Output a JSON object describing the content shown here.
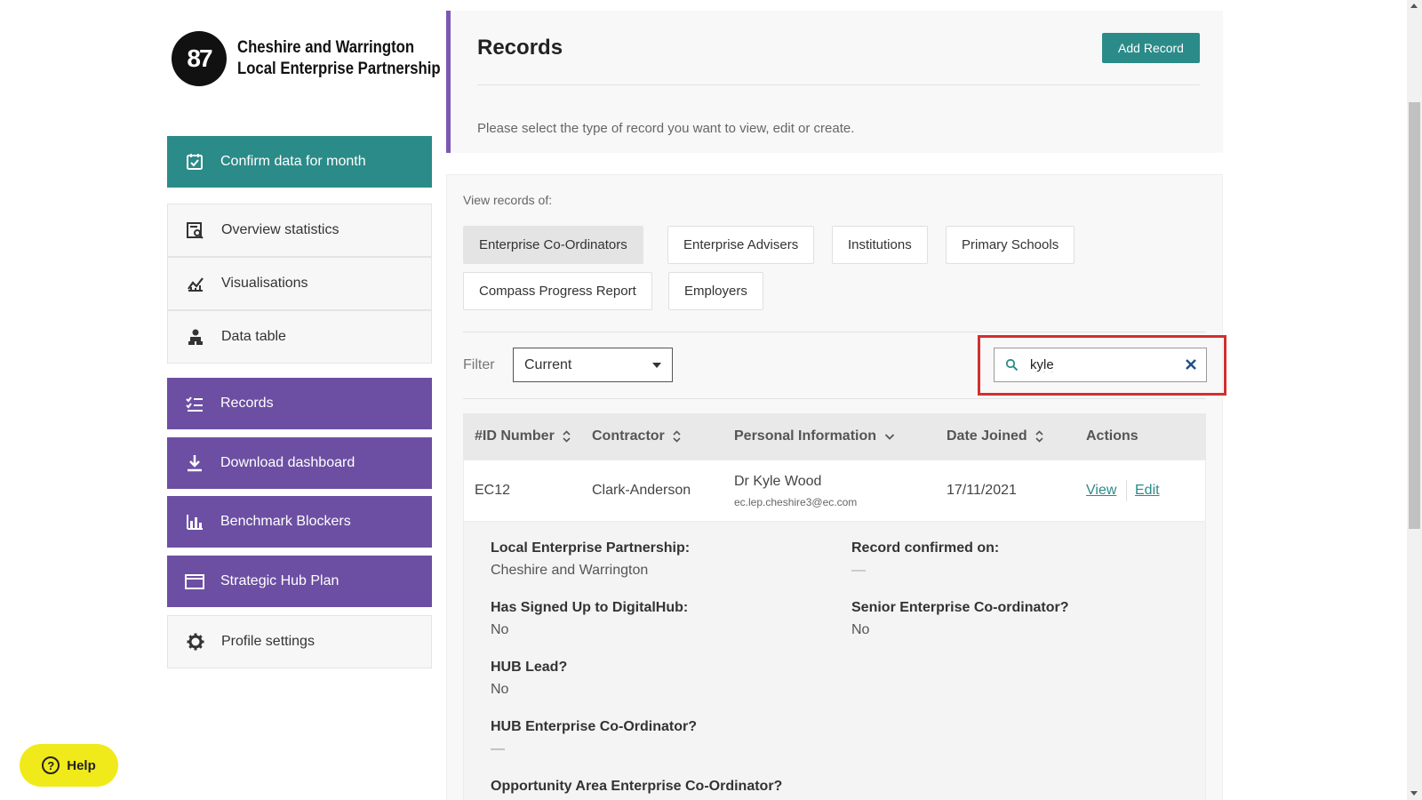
{
  "brand": {
    "logo_mark": "87",
    "name_line1": "Cheshire and Warrington",
    "name_line2": "Local Enterprise Partnership"
  },
  "sidebar": {
    "items": [
      {
        "label": "Confirm data for month",
        "icon": "calendar-check-icon"
      },
      {
        "label": "Overview statistics",
        "icon": "search-document-icon"
      },
      {
        "label": "Visualisations",
        "icon": "line-chart-icon"
      },
      {
        "label": "Data table",
        "icon": "user-table-icon"
      },
      {
        "label": "Records",
        "icon": "list-check-icon"
      },
      {
        "label": "Download dashboard",
        "icon": "download-icon"
      },
      {
        "label": "Benchmark Blockers",
        "icon": "bar-chart-icon"
      },
      {
        "label": "Strategic Hub Plan",
        "icon": "folder-icon"
      },
      {
        "label": "Profile settings",
        "icon": "gear-icon"
      }
    ]
  },
  "header": {
    "title": "Records",
    "add_button": "Add Record",
    "description": "Please select the type of record you want to view, edit or create."
  },
  "records": {
    "view_label": "View records of:",
    "tabs": [
      "Enterprise Co-Ordinators",
      "Enterprise Advisers",
      "Institutions",
      "Primary Schools",
      "Compass Progress Report",
      "Employers"
    ],
    "active_tab": "Enterprise Co-Ordinators",
    "filter_label": "Filter",
    "filter_value": "Current",
    "search_value": "kyle"
  },
  "table": {
    "headers": [
      "#ID Number",
      "Contractor",
      "Personal Information",
      "Date Joined",
      "Actions"
    ],
    "row": {
      "id": "EC12",
      "contractor": "Clark-Anderson",
      "name": "Dr Kyle Wood",
      "email": "ec.lep.cheshire3@ec.com",
      "date_joined": "17/11/2021",
      "view": "View",
      "edit": "Edit"
    }
  },
  "details": {
    "lep_label": "Local Enterprise Partnership:",
    "lep_value": "Cheshire and Warrington",
    "confirmed_label": "Record confirmed on:",
    "confirmed_value": "—",
    "digitalhub_label": "Has Signed Up to DigitalHub:",
    "digitalhub_value": "No",
    "senior_label": "Senior Enterprise Co-ordinator?",
    "senior_value": "No",
    "hub_lead_label": "HUB Lead?",
    "hub_lead_value": "No",
    "hub_eco_label": "HUB Enterprise Co-Ordinator?",
    "hub_eco_value": "—",
    "opportunity_label": "Opportunity Area Enterprise Co-Ordinator?"
  },
  "help": {
    "label": "Help"
  },
  "colors": {
    "teal": "#2b8b88",
    "purple": "#6c4fa3",
    "highlight": "#d32f2f",
    "help_yellow": "#f1ea1a"
  }
}
